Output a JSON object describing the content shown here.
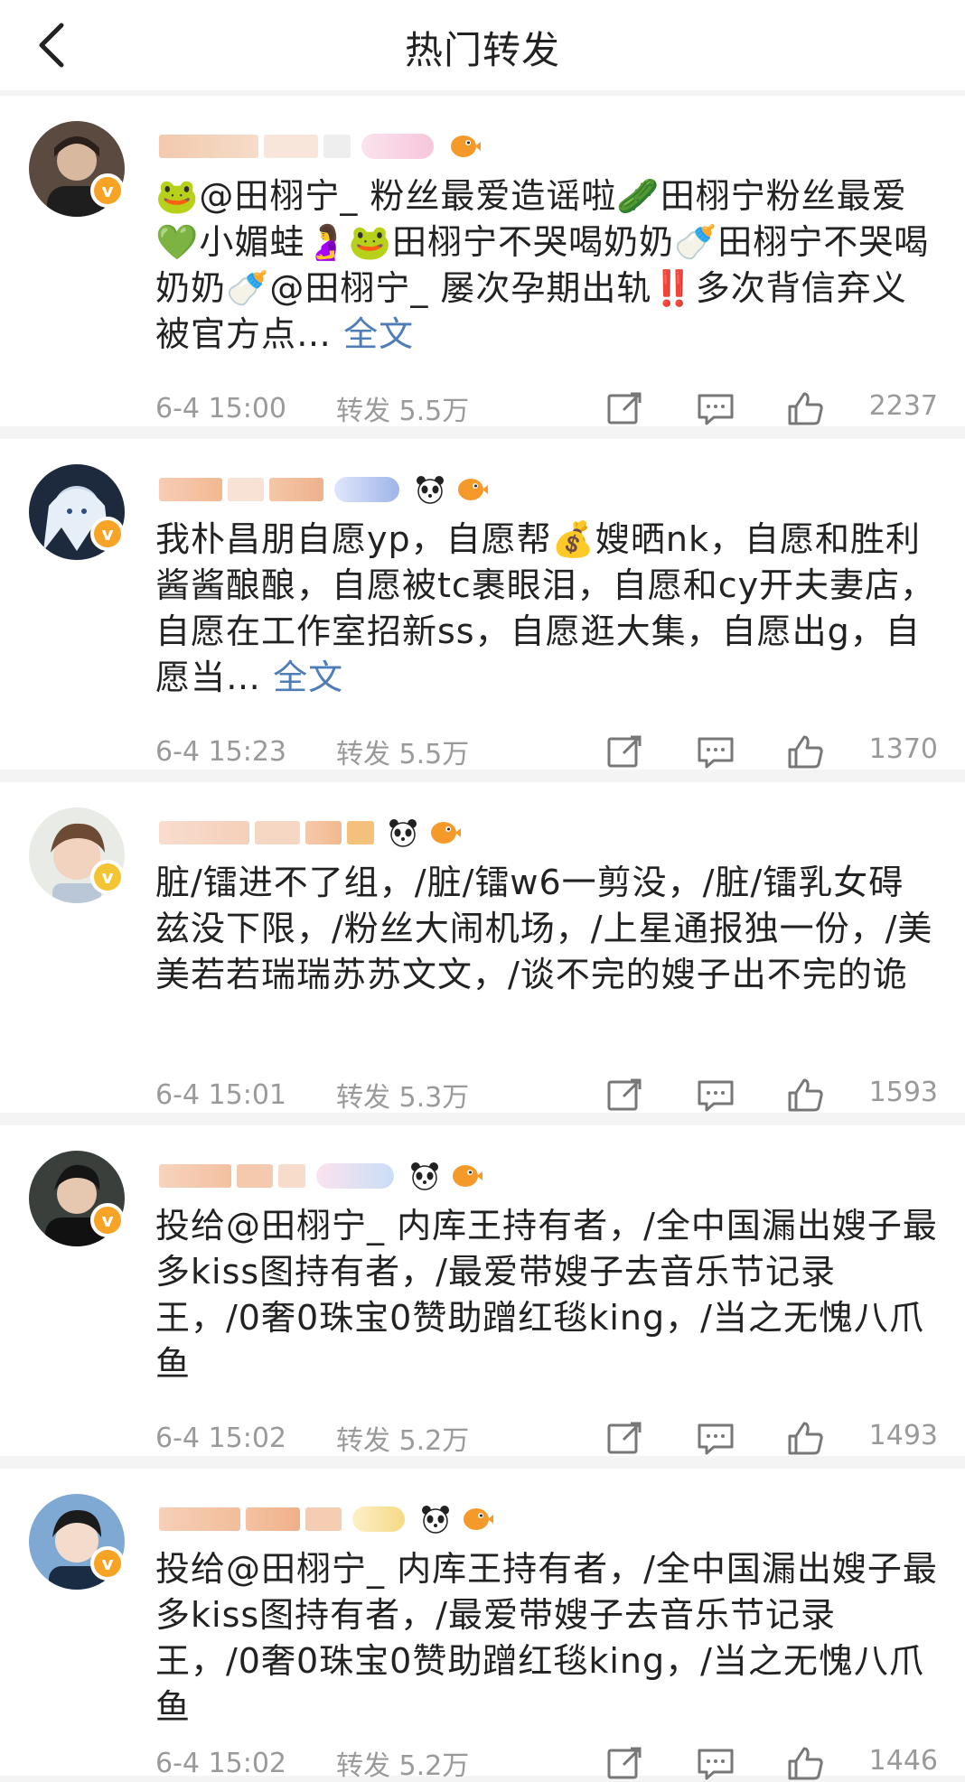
{
  "nav": {
    "title": "热门转发"
  },
  "posts": [
    {
      "content": "🐸@田栩宁_ 粉丝最爱造谣啦🥒田栩宁粉丝最爱💚小媚蛙🤰🐸田栩宁不哭喝奶奶🍼田栩宁不哭喝奶奶🍼@田栩宁_ 屡次孕期出轨‼️多次背信弃义被官方点…",
      "more": "全文",
      "time": "6-4 15:00",
      "forward": "转发 5.5万",
      "likes": "2237"
    },
    {
      "content": "我朴昌朋自愿yp，自愿帮💰嫂晒nk，自愿和胜利酱酱酿酿，自愿被tc裹眼泪，自愿和cy开夫妻店，自愿在工作室招新ss，自愿逛大集，自愿出g，自愿当…",
      "more": "全文",
      "time": "6-4 15:23",
      "forward": "转发 5.5万",
      "likes": "1370"
    },
    {
      "content": "脏/镭进不了组，/脏/镭w6一剪没，/脏/镭乳女碍兹没下限，/粉丝大闹机场，/上星通报独一份，/美美若若瑞瑞苏苏文文，/谈不完的嫂子出不完的诡",
      "more": "",
      "time": "6-4 15:01",
      "forward": "转发 5.3万",
      "likes": "1593"
    },
    {
      "content": "投给@田栩宁_ 内库王持有者，/全中国漏出嫂子最多kiss图持有者，/最爱带嫂子去音乐节记录王，/0奢0珠宝0赞助蹭红毯king，/当之无愧八爪鱼",
      "more": "",
      "time": "6-4 15:02",
      "forward": "转发 5.2万",
      "likes": "1493"
    },
    {
      "content": "投给@田栩宁_ 内库王持有者，/全中国漏出嫂子最多kiss图持有者，/最爱带嫂子去音乐节记录王，/0奢0珠宝0赞助蹭红毯king，/当之无愧八爪鱼",
      "more": "",
      "time": "6-4 15:02",
      "forward": "转发 5.2万",
      "likes": "1446"
    }
  ],
  "icons": {
    "back": "chevron-left-icon",
    "share": "share-icon",
    "comment": "comment-icon",
    "like": "thumb-up-icon",
    "verified": "verified-v-icon"
  },
  "colors": {
    "link": "#4e7db8",
    "meta": "#9a9a9a",
    "verified": "#f7a325"
  }
}
